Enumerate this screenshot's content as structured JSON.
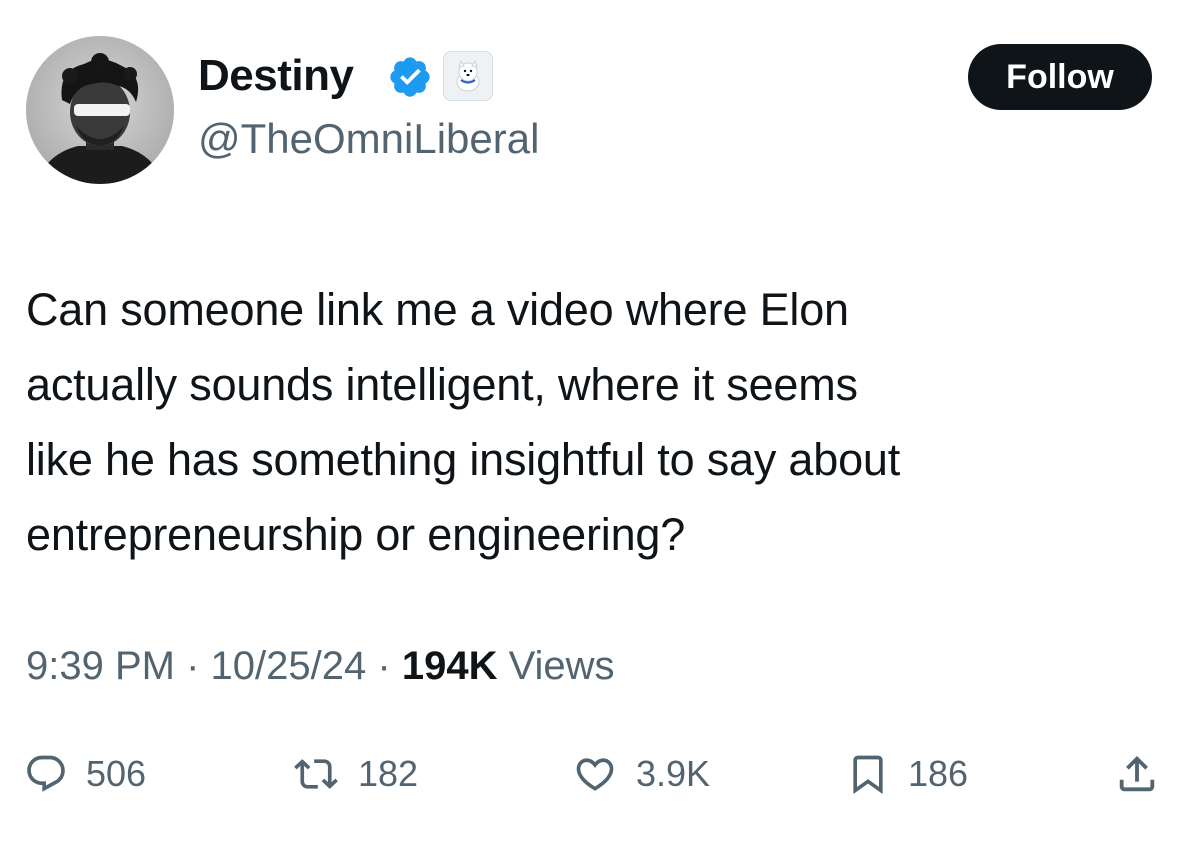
{
  "tweet": {
    "author": {
      "display_name": "Destiny",
      "handle": "@TheOmniLiberal",
      "verified": true,
      "verified_color": "#1d9bf0"
    },
    "follow_label": "Follow",
    "text": "Can someone link me a video where Elon\nactually sounds intelligent, where it seems\nlike he has something insightful to say about\nentrepreneurship or engineering?",
    "time": "9:39 PM",
    "date": "10/25/24",
    "separator": "·",
    "views_count": "194K",
    "views_label": "Views",
    "actions": {
      "replies": "506",
      "reposts": "182",
      "likes": "3.9K",
      "bookmarks": "186"
    }
  },
  "icons": {
    "reply": "reply-bubble-icon",
    "repost": "repost-arrows-icon",
    "like": "heart-icon",
    "bookmark": "bookmark-icon",
    "share": "share-upload-icon",
    "verified": "verified-badge-icon",
    "affiliate": "affiliate-badge-icon"
  },
  "colors": {
    "text_primary": "#0f1419",
    "text_secondary": "#536471",
    "button_bg": "#0f1419",
    "button_text": "#ffffff"
  }
}
